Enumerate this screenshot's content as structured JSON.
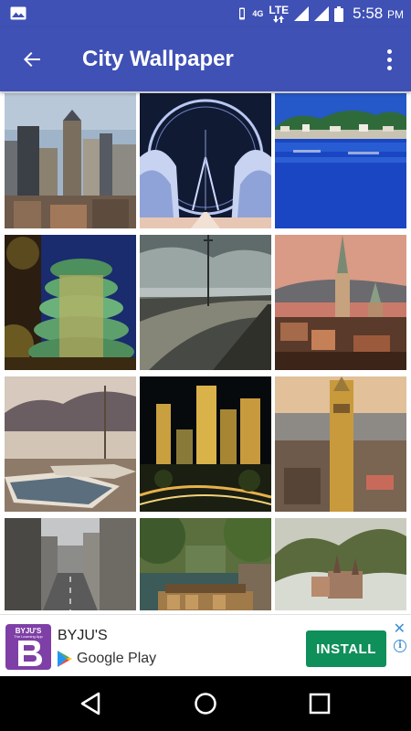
{
  "status_bar": {
    "network_type": "4G",
    "network_label": "LTE",
    "time": "5:58",
    "ampm": "PM",
    "icons": [
      "gallery-icon",
      "vibrate-icon",
      "signal-icon",
      "battery-icon"
    ]
  },
  "app_bar": {
    "title": "City Wallpaper",
    "back_icon": "arrow-back-icon",
    "menu_icon": "more-vert-icon"
  },
  "gallery": {
    "tiles": [
      {
        "subject": "new-york-skyline"
      },
      {
        "subject": "london-eye-night"
      },
      {
        "subject": "harbor-reflection"
      },
      {
        "subject": "spiral-tower-night"
      },
      {
        "subject": "seaside-promenade"
      },
      {
        "subject": "zurich-church-spires"
      },
      {
        "subject": "lake-rowboats"
      },
      {
        "subject": "los-angeles-night"
      },
      {
        "subject": "munich-town-hall"
      },
      {
        "subject": "city-street-avenue"
      },
      {
        "subject": "canal-boats"
      },
      {
        "subject": "misty-castle-hill"
      }
    ]
  },
  "ad": {
    "logo_text": "BYJU'S",
    "logo_subtext": "The Learning App",
    "app_name": "BYJU'S",
    "store_label": "Google Play",
    "install_label": "INSTALL",
    "close_symbol": "✕",
    "info_symbol": "i"
  },
  "colors": {
    "primary": "#3f51b5",
    "install_green": "#0f8f5a",
    "ad_accent": "#3b8fd6"
  },
  "nav_bar": {
    "icons": [
      "nav-back-icon",
      "nav-home-icon",
      "nav-recents-icon"
    ]
  }
}
